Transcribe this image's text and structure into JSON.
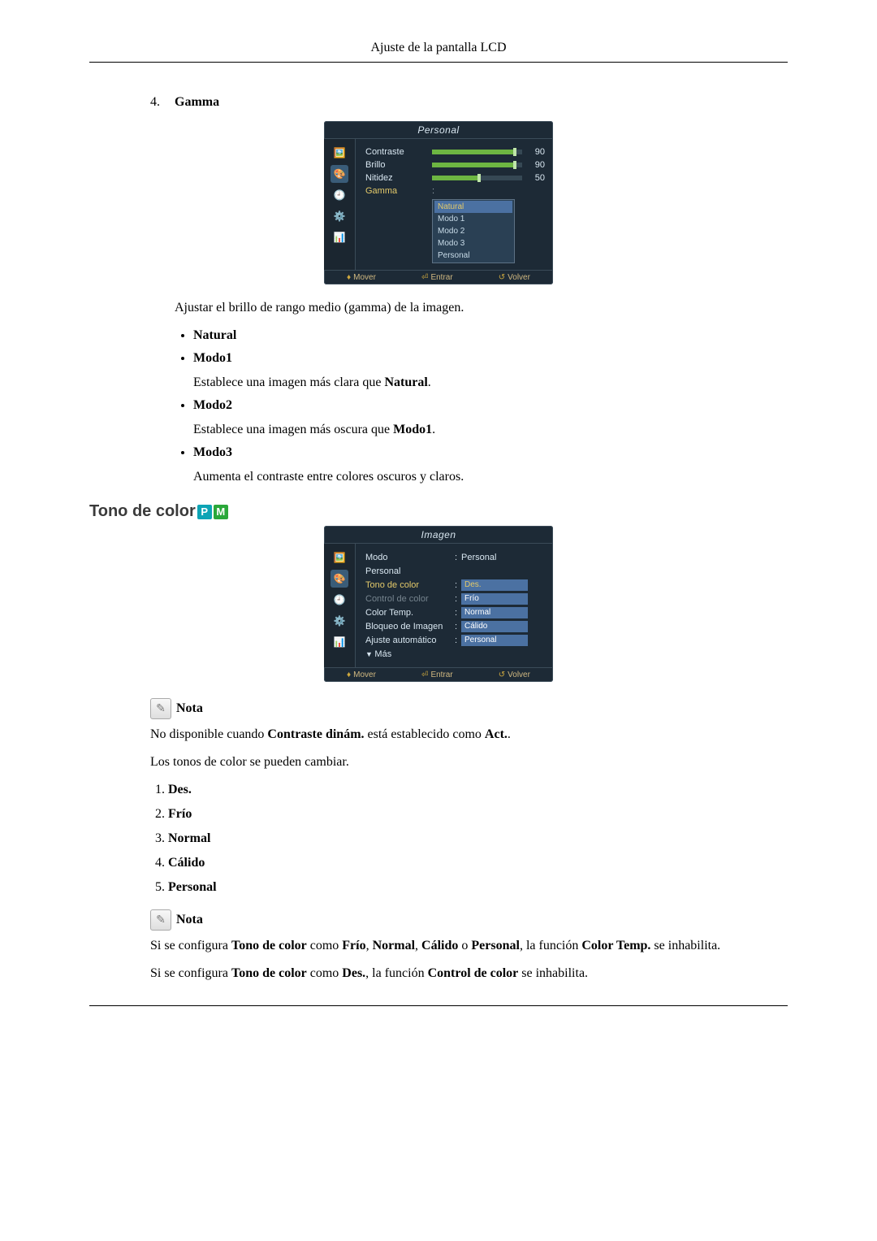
{
  "header": {
    "title": "Ajuste de la pantalla LCD"
  },
  "gamma": {
    "num": "4.",
    "label": "Gamma",
    "description": "Ajustar el brillo de rango medio (gamma) de la imagen.",
    "bullets": {
      "natural": {
        "label": "Natural"
      },
      "modo1": {
        "label": "Modo1",
        "desc_prefix": "Establece una imagen más clara que ",
        "desc_bold": "Natural",
        "desc_suffix": "."
      },
      "modo2": {
        "label": "Modo2",
        "desc_prefix": "Establece una imagen más oscura que ",
        "desc_bold": "Modo1",
        "desc_suffix": "."
      },
      "modo3": {
        "label": "Modo3",
        "desc": "Aumenta el contraste entre colores oscuros y claros."
      }
    }
  },
  "osd1": {
    "title": "Personal",
    "rows": {
      "contraste": {
        "label": "Contraste",
        "value": "90"
      },
      "brillo": {
        "label": "Brillo",
        "value": "90"
      },
      "nitidez": {
        "label": "Nitidez",
        "value": "50"
      },
      "gamma": {
        "label": "Gamma"
      }
    },
    "dropdown": [
      "Natural",
      "Modo 1",
      "Modo 2",
      "Modo 3",
      "Personal"
    ],
    "footer": {
      "move": "Mover",
      "enter": "Entrar",
      "back": "Volver"
    }
  },
  "tono_heading": "Tono de color",
  "badges": {
    "p": "P",
    "m": "M"
  },
  "osd2": {
    "title": "Imagen",
    "rows": {
      "modo": {
        "label": "Modo",
        "value": "Personal"
      },
      "personal": {
        "label": "Personal"
      },
      "tono": {
        "label": "Tono de color",
        "value": "Des."
      },
      "control": {
        "label": "Control de color",
        "value": "Frío"
      },
      "colortemp": {
        "label": "Color Temp.",
        "value": "Normal"
      },
      "bloqueo": {
        "label": "Bloqueo de Imagen",
        "value": "Cálido"
      },
      "ajuste": {
        "label": "Ajuste automático",
        "value": "Personal"
      },
      "mas": {
        "label": "Más"
      }
    },
    "footer": {
      "move": "Mover",
      "enter": "Entrar",
      "back": "Volver"
    }
  },
  "nota": {
    "label": "Nota"
  },
  "nota1": {
    "line1_prefix": "No disponible cuando ",
    "line1_b1": "Contraste dinám.",
    "line1_mid": " está establecido como ",
    "line1_b2": "Act.",
    "line1_suffix": ".",
    "line2": "Los tonos de color se pueden cambiar."
  },
  "list": {
    "i1": "Des.",
    "i2": "Frío",
    "i3": "Normal",
    "i4": "Cálido",
    "i5": "Personal"
  },
  "nota2": {
    "p1_a": "Si se configura ",
    "p1_b": "Tono de color",
    "p1_c": " como ",
    "p1_d": "Frío",
    "p1_e": ", ",
    "p1_f": "Normal",
    "p1_g": ", ",
    "p1_h": "Cálido",
    "p1_i": " o ",
    "p1_j": "Personal",
    "p1_k": ", la función ",
    "p1_l": "Color Temp.",
    "p1_m": " se inhabilita.",
    "p2_a": "Si se configura ",
    "p2_b": "Tono de color",
    "p2_c": " como ",
    "p2_d": "Des.",
    "p2_e": ", la función ",
    "p2_f": "Control de color",
    "p2_g": " se inhabilita."
  }
}
